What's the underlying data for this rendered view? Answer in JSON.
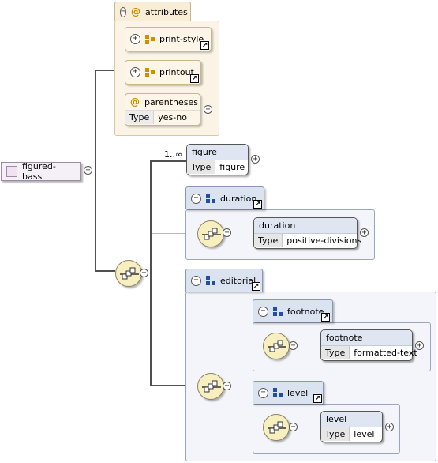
{
  "colors": {
    "accent_orange": "#d18f00",
    "accent_blue": "#1f4f9e",
    "line": "#505050"
  },
  "root": {
    "name": "figured-bass"
  },
  "attributes_group": {
    "label": "attributes",
    "items": [
      {
        "name": "print-style"
      },
      {
        "name": "printout"
      }
    ],
    "parentheses": {
      "name": "parentheses",
      "type_key": "Type",
      "type_value": "yes-no"
    }
  },
  "figure": {
    "name": "figure",
    "type_key": "Type",
    "type_value": "figure",
    "occurs": "1..∞"
  },
  "duration": {
    "group_label": "duration",
    "element": {
      "name": "duration",
      "type_key": "Type",
      "type_value": "positive-divisions"
    }
  },
  "editorial": {
    "group_label": "editorial",
    "footnote": {
      "group_label": "footnote",
      "element": {
        "name": "footnote",
        "type_key": "Type",
        "type_value": "formatted-text"
      }
    },
    "level": {
      "group_label": "level",
      "element": {
        "name": "level",
        "type_key": "Type",
        "type_value": "level"
      }
    }
  },
  "icons": {
    "collapse": "−",
    "expand": "+",
    "attr": "@",
    "link": "↗"
  }
}
